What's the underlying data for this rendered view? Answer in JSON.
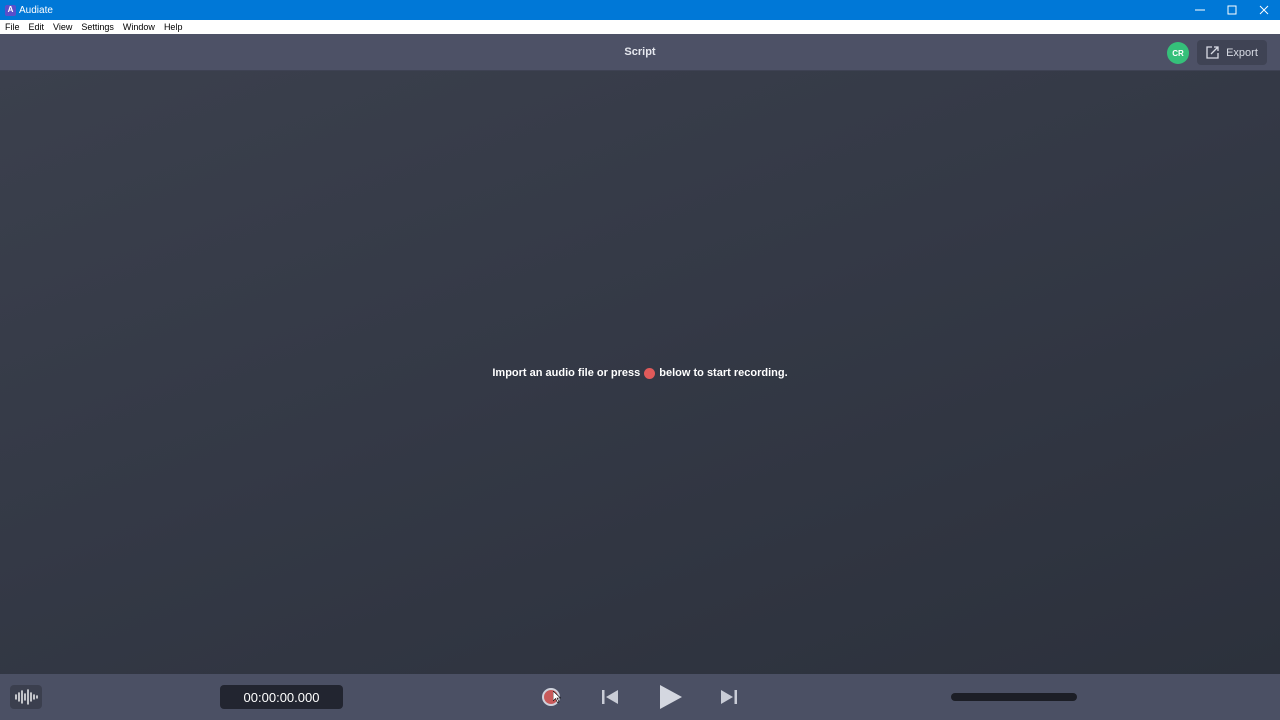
{
  "window": {
    "title": "Audiate",
    "app_icon_letter": "A"
  },
  "menu": {
    "items": [
      "File",
      "Edit",
      "View",
      "Settings",
      "Window",
      "Help"
    ]
  },
  "header": {
    "title": "Script",
    "avatar_initials": "CR",
    "export_label": "Export"
  },
  "main": {
    "empty_message_before": "Import an audio file or press",
    "empty_message_after": "below to start recording."
  },
  "player": {
    "timecode": "00:00:00.000"
  },
  "colors": {
    "titlebar": "#0078d7",
    "record": "#e05a5a",
    "avatar": "#35c07a"
  }
}
